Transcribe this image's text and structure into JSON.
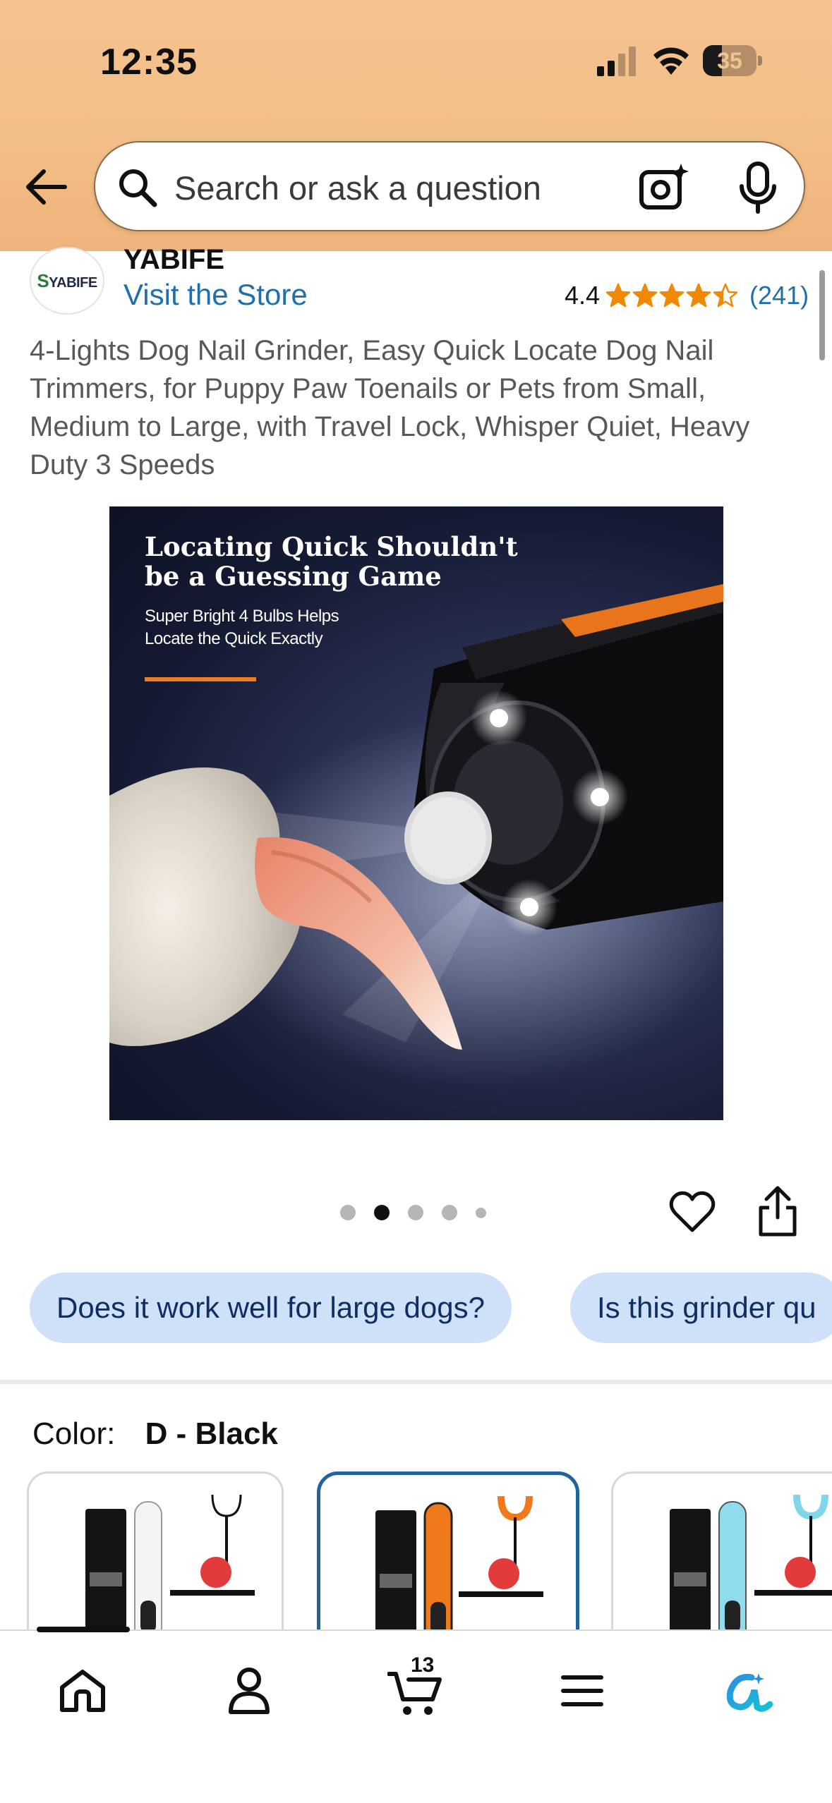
{
  "status_bar": {
    "time": "12:35",
    "battery": "35",
    "battery_level": 0.35,
    "icons": [
      "cellular-signal-icon",
      "wifi-icon",
      "battery-icon"
    ]
  },
  "header": {
    "back_icon": "back-arrow-icon",
    "search": {
      "placeholder": "Search or ask a question",
      "icons": [
        "search-icon",
        "camera-sparkle-icon",
        "microphone-icon"
      ]
    },
    "colors": {
      "background": "#f3bf88"
    }
  },
  "brand": {
    "logo_text": "YABIFE",
    "name": "YABIFE",
    "visit_store": "Visit the Store"
  },
  "rating": {
    "value": "4.4",
    "stars": 4.4,
    "count": "(241)",
    "color": "#f08804"
  },
  "product": {
    "title": "4-Lights Dog Nail Grinder, Easy Quick Locate Dog Nail Trimmers, for Puppy Paw Toenails or Pets from Small, Medium to Large, with Travel Lock, Whisper Quiet, Heavy Duty 3 Speeds"
  },
  "hero_image": {
    "headline": "Locating Quick Shouldn't\nbe a Guessing Game",
    "subtext": "Super Bright 4 Bulbs Helps\nLocate the Quick Exactly",
    "accent": "#ef7d1f"
  },
  "carousel": {
    "total_dots": 5,
    "active_index": 1,
    "actions": [
      "heart-icon",
      "share-icon"
    ]
  },
  "questions": [
    "Does it work well for large dogs?",
    "Is this grinder qu"
  ],
  "color_selector": {
    "label": "Color:",
    "selected": "D - Black",
    "options": [
      {
        "accent": "#ffffff",
        "selected": false
      },
      {
        "accent": "#f07a1a",
        "selected": true
      },
      {
        "accent": "#7fd6e8",
        "selected": false
      }
    ]
  },
  "tab_bar": {
    "tabs": [
      "home-icon",
      "account-icon",
      "cart-icon",
      "menu-icon",
      "rufus-icon"
    ],
    "cart_count": "13"
  }
}
